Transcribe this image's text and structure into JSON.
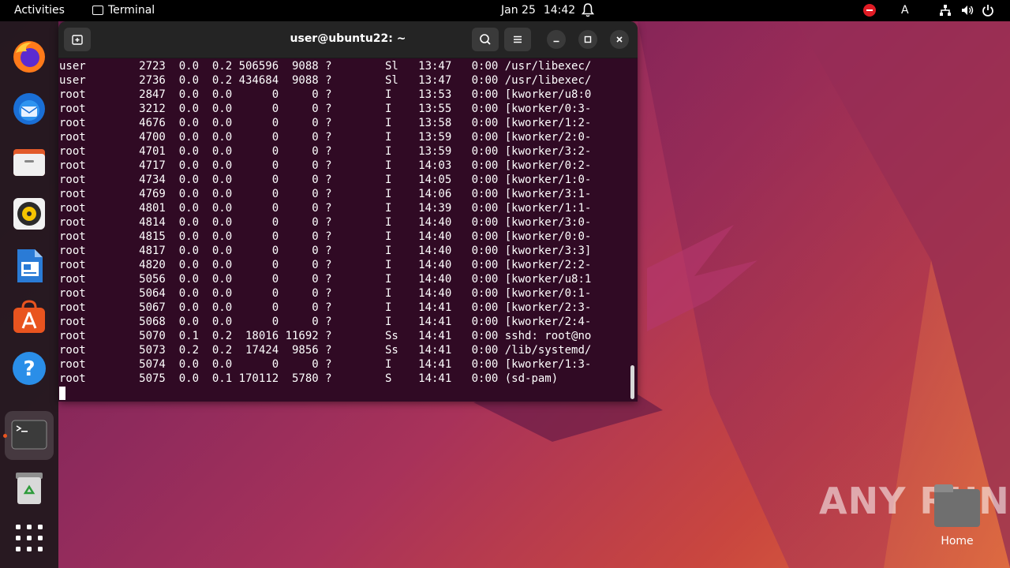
{
  "topbar": {
    "activities": "Activities",
    "app_name": "Terminal",
    "date": "Jan 25",
    "time": "14:42",
    "lang": "A"
  },
  "window": {
    "title": "user@ubuntu22: ~"
  },
  "terminal_lines": [
    "user        2723  0.0  0.2 506596  9088 ?        Sl   13:47   0:00 /usr/libexec/",
    "user        2736  0.0  0.2 434684  9088 ?        Sl   13:47   0:00 /usr/libexec/",
    "root        2847  0.0  0.0      0     0 ?        I    13:53   0:00 [kworker/u8:0",
    "root        3212  0.0  0.0      0     0 ?        I    13:55   0:00 [kworker/0:3-",
    "root        4676  0.0  0.0      0     0 ?        I    13:58   0:00 [kworker/1:2-",
    "root        4700  0.0  0.0      0     0 ?        I    13:59   0:00 [kworker/2:0-",
    "root        4701  0.0  0.0      0     0 ?        I    13:59   0:00 [kworker/3:2-",
    "root        4717  0.0  0.0      0     0 ?        I    14:03   0:00 [kworker/0:2-",
    "root        4734  0.0  0.0      0     0 ?        I    14:05   0:00 [kworker/1:0-",
    "root        4769  0.0  0.0      0     0 ?        I    14:06   0:00 [kworker/3:1-",
    "root        4801  0.0  0.0      0     0 ?        I    14:39   0:00 [kworker/1:1-",
    "root        4814  0.0  0.0      0     0 ?        I    14:40   0:00 [kworker/3:0-",
    "root        4815  0.0  0.0      0     0 ?        I    14:40   0:00 [kworker/0:0-",
    "root        4817  0.0  0.0      0     0 ?        I    14:40   0:00 [kworker/3:3]",
    "root        4820  0.0  0.0      0     0 ?        I    14:40   0:00 [kworker/2:2-",
    "root        5056  0.0  0.0      0     0 ?        I    14:40   0:00 [kworker/u8:1",
    "root        5064  0.0  0.0      0     0 ?        I    14:40   0:00 [kworker/0:1-",
    "root        5067  0.0  0.0      0     0 ?        I    14:41   0:00 [kworker/2:3-",
    "root        5068  0.0  0.0      0     0 ?        I    14:41   0:00 [kworker/2:4-",
    "root        5070  0.1  0.2  18016 11692 ?        Ss   14:41   0:00 sshd: root@no",
    "root        5073  0.2  0.2  17424  9856 ?        Ss   14:41   0:00 /lib/systemd/",
    "root        5074  0.0  0.0      0     0 ?        I    14:41   0:00 [kworker/1:3-",
    "root        5075  0.0  0.1 170112  5780 ?        S    14:41   0:00 (sd-pam)"
  ],
  "desktop": {
    "home_label": "Home",
    "watermark": "ANY RUN"
  },
  "dock": {
    "items": [
      "firefox-icon",
      "thunderbird-icon",
      "files-icon",
      "rhythmbox-icon",
      "writer-icon",
      "app-center-icon",
      "help-icon",
      "terminal-icon",
      "trash-icon",
      "show-apps-icon"
    ]
  },
  "colors": {
    "terminal_bg": "#300a24",
    "titlebar_bg": "#242424",
    "accent": "#e9541f"
  }
}
